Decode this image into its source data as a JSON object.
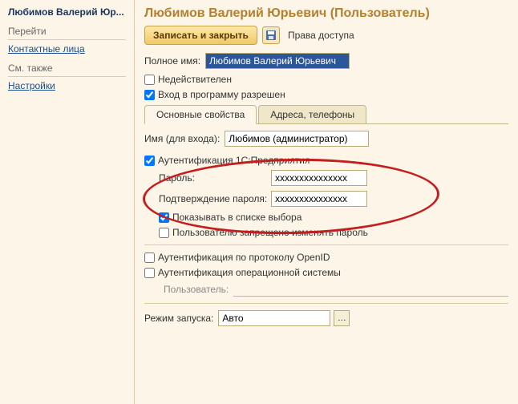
{
  "sidebar": {
    "title": "Любимов Валерий Юр...",
    "section1": "Перейти",
    "links1": [
      "Контактные лица"
    ],
    "section2": "См. также",
    "links2": [
      "Настройки"
    ]
  },
  "header": {
    "title": "Любимов Валерий Юрьевич (Пользователь)"
  },
  "toolbar": {
    "save_close": "Записать и закрыть",
    "access_rights": "Права доступа"
  },
  "form": {
    "fullname_label": "Полное имя:",
    "fullname_value": "Любимов Валерий Юрьевич",
    "invalid_label": "Недействителен",
    "login_allowed_label": "Вход в программу разрешен"
  },
  "tabs": {
    "main": "Основные свойства",
    "addresses": "Адреса, телефоны"
  },
  "login": {
    "name_label": "Имя (для входа):",
    "name_value": "Любимов (администратор)"
  },
  "auth1c": {
    "label": "Аутентификация 1С:Предприятия",
    "password_label": "Пароль:",
    "password_value": "xxxxxxxxxxxxxxx",
    "confirm_label": "Подтверждение пароля:",
    "confirm_value": "xxxxxxxxxxxxxxx",
    "show_in_list": "Показывать в списке выбора",
    "deny_change": "Пользователю запрещено изменять пароль"
  },
  "openid": {
    "label": "Аутентификация по протоколу OpenID"
  },
  "os_auth": {
    "label": "Аутентификация операционной системы",
    "user_label": "Пользователь:"
  },
  "run_mode": {
    "label": "Режим запуска:",
    "value": "Авто"
  }
}
